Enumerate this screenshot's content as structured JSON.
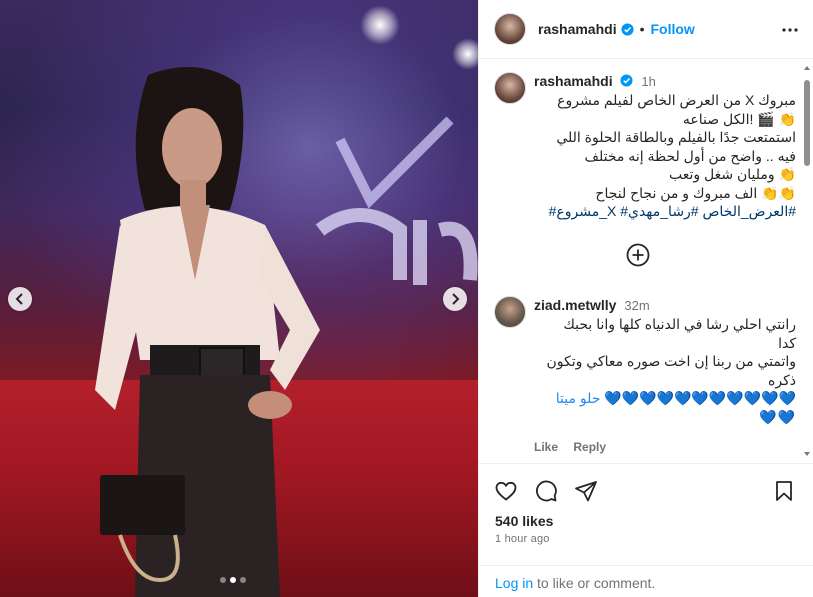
{
  "header": {
    "username": "rashamahdi",
    "separator": "•",
    "follow_label": "Follow"
  },
  "caption": {
    "username": "rashamahdi",
    "time": "1h",
    "lines": [
      "مبروك X من العرض الخاص لفيلم مشروع",
      "👏 🎬 !الكل صناعه",
      "استمتعت جدًا بالفيلم وبالطاقة الحلوة اللي",
      "فيه .. واضح من أول لحظة إنه مختلف",
      "👏 ومليان شغل وتعب",
      "👏👏 الف مبروك و من نجاح لنجاح"
    ],
    "hashtags": "#العرض_الخاص #رشا_مهدي# X_مشروع#"
  },
  "comment": {
    "username": "ziad.metwlly",
    "time": "32m",
    "lines": [
      "رانتي احلي رشا في الدنياه كلها وانا بحبك",
      "كدا",
      "واتمتي من ربنا إن اخت صوره معاكي وتكون",
      "ذكره",
      "💙💙💙💙💙💙💙💙💙💙💙 حلو ميتا",
      "💙💙"
    ],
    "like_label": "Like",
    "reply_label": "Reply"
  },
  "footer": {
    "likes": "540 likes",
    "time_ago": "1 hour ago",
    "login_link": "Log in",
    "login_rest": " to like or comment."
  },
  "carousel": {
    "total_slides": 3,
    "active_slide": 1
  },
  "icons": {
    "verified": "verified-badge-icon",
    "more": "more-options-icon",
    "prev": "chevron-left-icon",
    "next": "chevron-right-icon",
    "load_more": "plus-circle-icon",
    "like": "heart-icon",
    "comment": "comment-bubble-icon",
    "share": "paper-plane-icon",
    "save": "bookmark-icon"
  },
  "colors": {
    "accent": "#0095f6",
    "verified": "#0095f6",
    "hashtag": "#00376b",
    "muted": "#737373"
  }
}
